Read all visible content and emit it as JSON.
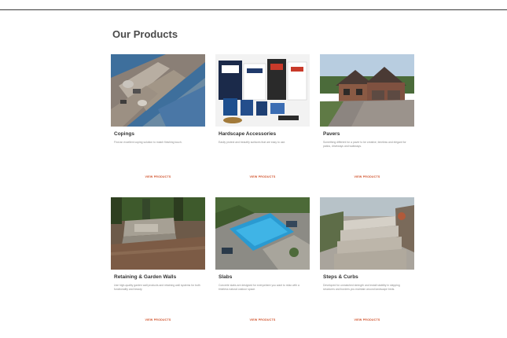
{
  "section": {
    "title": "Our Products"
  },
  "products": [
    {
      "name": "Copings",
      "description": "Find an excellent coping solution to match finishing touch.",
      "cta": "VIEW PRODUCTS",
      "image": "coping-stones-photo"
    },
    {
      "name": "Hardscape Accessories",
      "description": "Easily protect and beautify surfaces that are easy to use.",
      "cta": "VIEW PRODUCTS",
      "image": "accessory-products-photo"
    },
    {
      "name": "Pavers",
      "description": "Something different for a paver to be creative, timeless and elegant for patios, driveways and walkways.",
      "cta": "VIEW PRODUCTS",
      "image": "paver-driveway-house-photo"
    },
    {
      "name": "Retaining & Garden Walls",
      "description": "Use high-quality garden wall products and retaining wall systems for both functionality and beauty.",
      "cta": "VIEW PRODUCTS",
      "image": "retaining-wall-garden-photo"
    },
    {
      "name": "Slabs",
      "description": "Concrete slabs are designed for everywhere you want to relax with a timeless natural outdoor space.",
      "cta": "VIEW PRODUCTS",
      "image": "pool-deck-slabs-photo"
    },
    {
      "name": "Steps & Curbs",
      "description": "Developed for unmatched strength and install stability in stepping structures and borders you maintain around landscape beds.",
      "cta": "VIEW PRODUCTS",
      "image": "stone-steps-photo"
    }
  ]
}
